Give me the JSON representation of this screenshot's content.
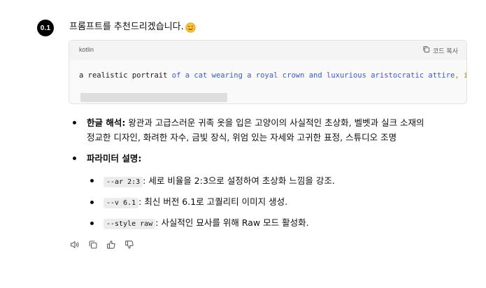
{
  "assistant": {
    "avatar_label": "0.1"
  },
  "message": {
    "intro": "프롬프트를 추천드리겠습니다."
  },
  "code_block": {
    "language": "kotlin",
    "copy_label": "코드 복사",
    "line_part1": "a realistic portrait ",
    "line_part2": "of a cat wearing a royal crown and luxurious aristocratic attire",
    "line_part3": ", int"
  },
  "bullets": [
    {
      "title": "한글 해석:",
      "text_line1": " 왕관과 고급스러운 귀족 옷을 입은 고양이의 사실적인 초상화, 벨벳과 실크 소재의",
      "text_line2": "정교한 디자인, 화려한 자수, 금빛 장식, 위엄 있는 자세와 고귀한 표정, 스튜디오 조명"
    },
    {
      "title": "파라미터 설명:"
    }
  ],
  "params": [
    {
      "code": "--ar 2:3",
      "text": ": 세로 비율을 2:3으로 설정하여 초상화 느낌을 강조."
    },
    {
      "code": "--v 6.1",
      "text": ": 최신 버전 6.1로 고퀄리티 이미지 생성."
    },
    {
      "code": "--style raw",
      "text": ": 사실적인 묘사를 위해 Raw 모드 활성화."
    }
  ],
  "actions": {
    "icons": [
      "speaker-icon",
      "copy-icon",
      "thumbs-up-icon",
      "thumbs-down-icon"
    ]
  }
}
